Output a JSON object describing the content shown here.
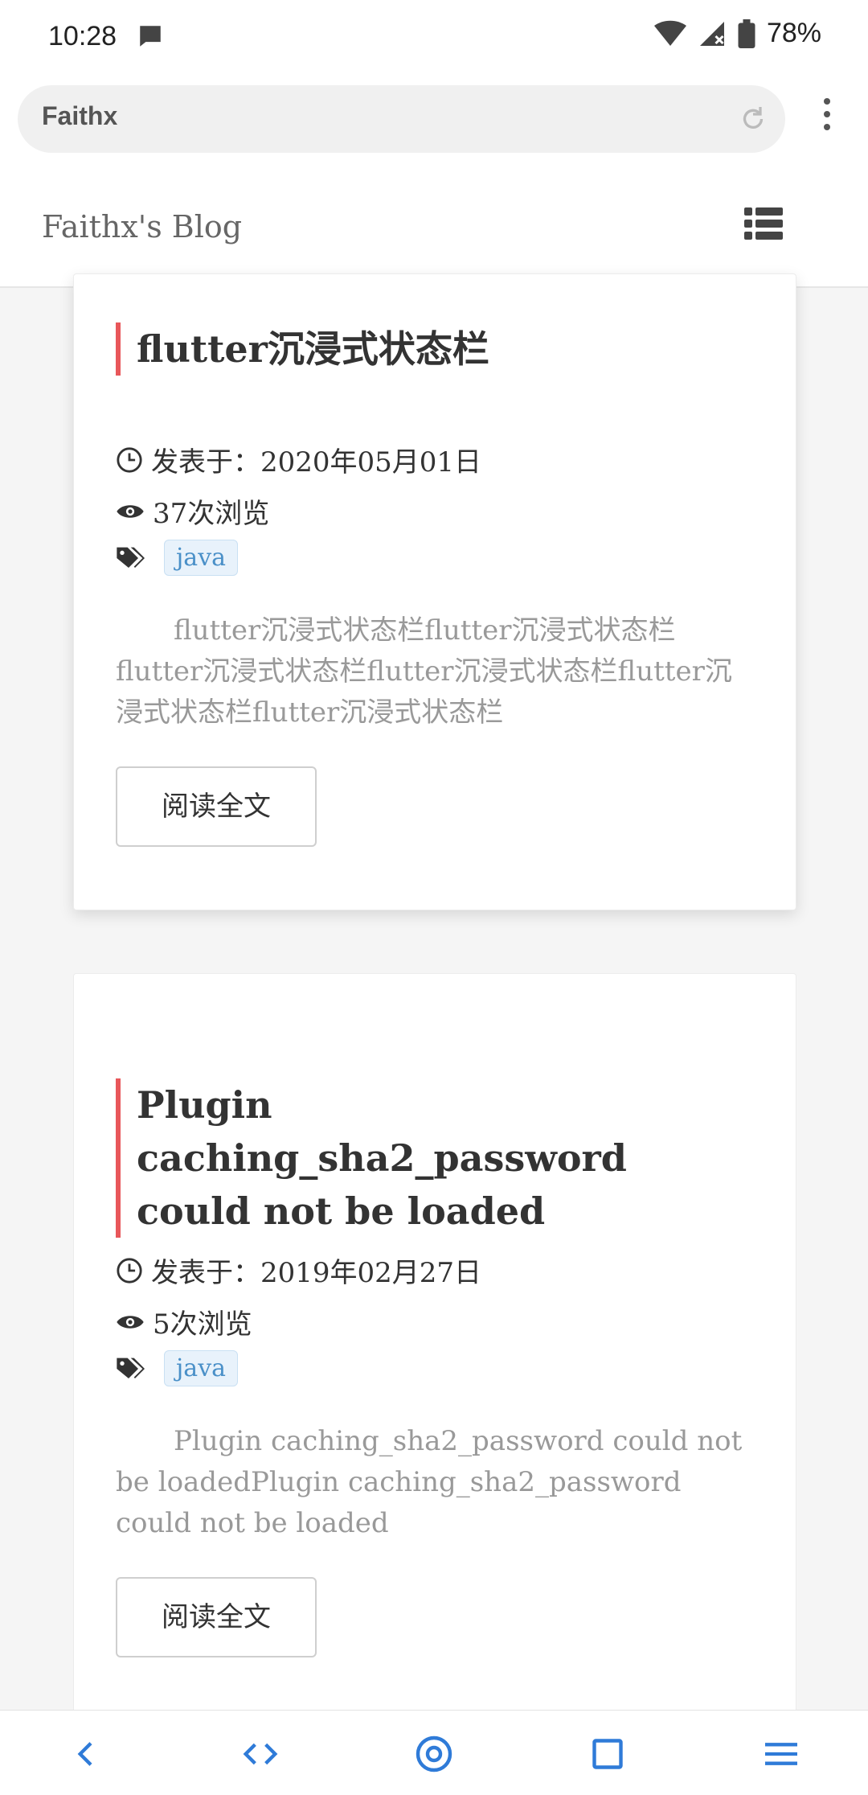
{
  "status_bar": {
    "time": "10:28",
    "battery": "78%",
    "icons": [
      "message-icon",
      "wifi-icon",
      "signal-icon",
      "battery-icon"
    ]
  },
  "browser": {
    "url": "Faithx",
    "icons": [
      "reload-icon",
      "kebab-menu-icon"
    ]
  },
  "header": {
    "title": "Faithx's Blog",
    "menu_icon": "list-menu-icon"
  },
  "posts": [
    {
      "title": "flutter沉浸式状态栏",
      "date": "发表于：2020年05月01日",
      "views": "37次浏览",
      "tag": "java",
      "excerpt": "flutter沉浸式状态栏flutter沉浸式状态栏flutter沉浸式状态栏flutter沉浸式状态栏flutter沉浸式状态栏flutter沉浸式状态栏",
      "read_more": "阅读全文"
    },
    {
      "title": "Plugin caching_sha2_password could not be loaded",
      "date": "发表于：2019年02月27日",
      "views": "5次浏览",
      "tag": "java",
      "excerpt": "Plugin caching_sha2_password could not be loadedPlugin caching_sha2_password could not be loaded",
      "read_more": "阅读全文"
    }
  ],
  "colors": {
    "accent_bar": "#e8575a",
    "tag_text": "#4a90c8",
    "tag_bg": "#e8f2fb"
  },
  "bottom_nav": {
    "icons": [
      "back-icon",
      "code-icon",
      "home-circle-icon",
      "tabs-square-icon",
      "hamburger-menu-icon"
    ]
  }
}
